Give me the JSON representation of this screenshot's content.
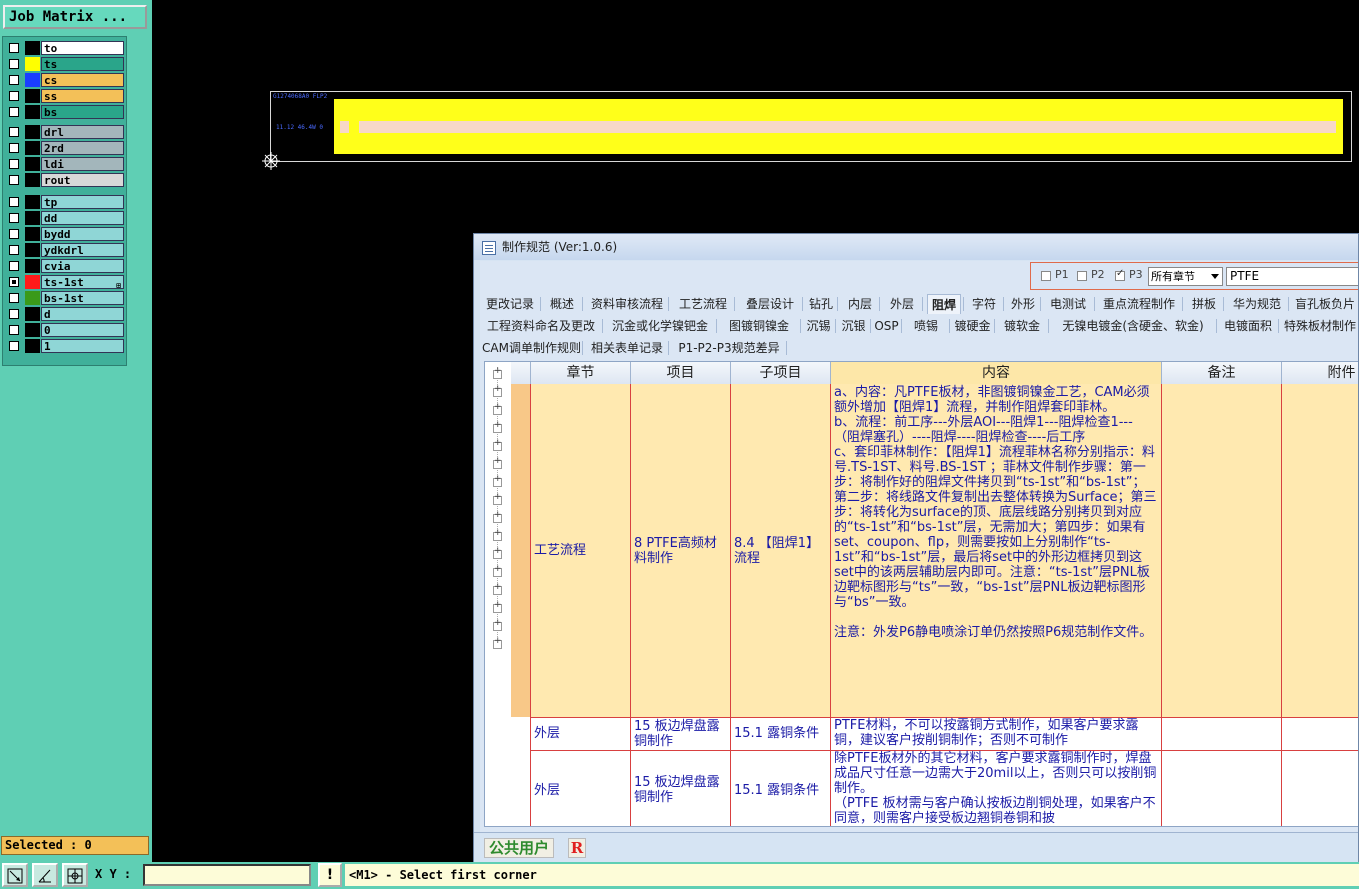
{
  "job_matrix": {
    "label": "Job Matrix ..."
  },
  "layers": [
    {
      "group": 1,
      "items": [
        {
          "name": "to",
          "swatch": "#000000",
          "bg": "#ffffff",
          "checked": false
        },
        {
          "name": "ts",
          "swatch": "#ffff00",
          "bg": "#2aa58a",
          "checked": false
        },
        {
          "name": "cs",
          "swatch": "#1a3dff",
          "bg": "#f3c058",
          "checked": false
        },
        {
          "name": "ss",
          "swatch": "#000000",
          "bg": "#f3c058",
          "checked": false
        },
        {
          "name": "bs",
          "swatch": "#000000",
          "bg": "#2aa58a",
          "checked": false
        }
      ]
    },
    {
      "group": 2,
      "items": [
        {
          "name": "drl",
          "swatch": "#000000",
          "bg": "#a3b6bb",
          "checked": false
        },
        {
          "name": "2rd",
          "swatch": "#000000",
          "bg": "#a3b6bb",
          "checked": false
        },
        {
          "name": "ldi",
          "swatch": "#000000",
          "bg": "#a3b6bb",
          "checked": false
        },
        {
          "name": "rout",
          "swatch": "#000000",
          "bg": "#d8d8d8",
          "checked": false
        }
      ]
    },
    {
      "group": 3,
      "items": [
        {
          "name": "tp",
          "swatch": "#000000",
          "bg": "#8fd6d6",
          "checked": false
        },
        {
          "name": "dd",
          "swatch": "#000000",
          "bg": "#8fd6d6",
          "checked": false
        },
        {
          "name": "bydd",
          "swatch": "#000000",
          "bg": "#8fd6d6",
          "checked": false
        },
        {
          "name": "ydkdrl",
          "swatch": "#000000",
          "bg": "#8fd6d6",
          "checked": false
        },
        {
          "name": "cvia",
          "swatch": "#000000",
          "bg": "#8fd6d6",
          "checked": false
        },
        {
          "name": "ts-1st",
          "swatch": "#ff1a1a",
          "bg": "#8fd6d6",
          "checked": true,
          "mark": "⊞"
        },
        {
          "name": "bs-1st",
          "swatch": "#3a9a1a",
          "bg": "#8fd6d6",
          "checked": false
        },
        {
          "name": "d",
          "swatch": "#000000",
          "bg": "#8fd6d6",
          "checked": false
        },
        {
          "name": "0",
          "swatch": "#000000",
          "bg": "#8fd6d6",
          "checked": false
        },
        {
          "name": "1",
          "swatch": "#000000",
          "bg": "#8fd6d6",
          "checked": false
        }
      ]
    }
  ],
  "selected": {
    "label": "Selected : 0"
  },
  "statusbar": {
    "xy_label": "X Y :",
    "xy_value": "",
    "warn": "!",
    "message": "<M1> - Select first corner"
  },
  "graphics": {
    "text1": "G1274068A0 FLP2",
    "text2": "11.12 46.4W 0"
  },
  "dialog": {
    "title": "制作规范 (Ver:1.0.6)",
    "filter": {
      "p1": "P1",
      "p2": "P2",
      "p3": "P3",
      "p1_checked": false,
      "p2_checked": false,
      "p3_checked": true,
      "section": "所有章节",
      "value": "PTFE"
    },
    "tabs_row1": [
      "更改记录",
      "概述",
      "资料审核流程",
      "工艺流程",
      "叠层设计",
      "钻孔",
      "内层",
      "外层",
      "阻焊",
      "字符",
      "外形",
      "电测试",
      "重点流程制作",
      "拼板",
      "华为规范",
      "盲孔板负片"
    ],
    "active_tab": "阻焊",
    "tabs_row2": [
      "工程资料命名及更改",
      "沉金或化学镍钯金",
      "图镀铜镍金",
      "沉锡",
      "沉银",
      "OSP",
      "喷锡",
      "镀硬金",
      "镀软金",
      "无镍电镀金(含硬金、软金)",
      "电镀面积",
      "特殊板材制作"
    ],
    "tabs_row3": [
      "CAM调单制作规则",
      "相关表单记录",
      "P1-P2-P3规范差异"
    ],
    "columns": [
      "章节",
      "项目",
      "子项目",
      "内容",
      "备注",
      "附件"
    ],
    "rows": [
      {
        "chapter": "工艺流程",
        "item": "8 PTFE高频材料制作",
        "subitem": "8.4 【阻焊1】流程",
        "content": "a、内容：凡PTFE板材，非图镀铜镍金工艺，CAM必须额外增加【阻焊1】流程，并制作阻焊套印菲林。\nb、流程：前工序---外层AOI---阻焊1---阻焊检查1---（阻焊塞孔）----阻焊----阻焊检查----后工序\nc、套印菲林制作：【阻焊1】流程菲林名称分别指示：料号.TS-1ST、料号.BS-1ST ；菲林文件制作步骤：第一步：将制作好的阻焊文件拷贝到“ts-1st”和“bs-1st”；第二步：将线路文件复制出去整体转换为Surface；第三步：将转化为surface的顶、底层线路分别拷贝到对应的“ts-1st”和“bs-1st”层，无需加大；第四步：如果有set、coupon、flp，则需要按如上分别制作“ts-1st”和“bs-1st”层，最后将set中的外形边框拷贝到这set中的该两层辅助层内即可。注意：“ts-1st”层PNL板边靶标图形与“ts”一致，“bs-1st”层PNL板边靶标图形与“bs”一致。\n\n注意：外发P6静电喷涂订单仍然按照P6规范制作文件。",
        "note": "",
        "attach": "",
        "selected": true
      },
      {
        "chapter": "外层",
        "item": "15 板边焊盘露铜制作",
        "subitem": "15.1 露铜条件",
        "content": "PTFE材料，不可以按露铜方式制作，如果客户要求露铜，建议客户按削铜制作；否则不可制作",
        "note": "",
        "attach": "",
        "selected": false
      },
      {
        "chapter": "外层",
        "item": "15 板边焊盘露铜制作",
        "subitem": "15.1 露铜条件",
        "content": "除PTFE板材外的其它材料，客户要求露铜制作时，焊盘成品尺寸任意一边需大于20mil以上，否则只可以按削铜制作。\n（PTFE 板材需与客户确认按板边削铜处理，如果客户不同意，则需客户接受板边翘铜卷铜和披",
        "note": "",
        "attach": "",
        "selected": false
      }
    ],
    "user": "公共用户",
    "role": "R"
  }
}
